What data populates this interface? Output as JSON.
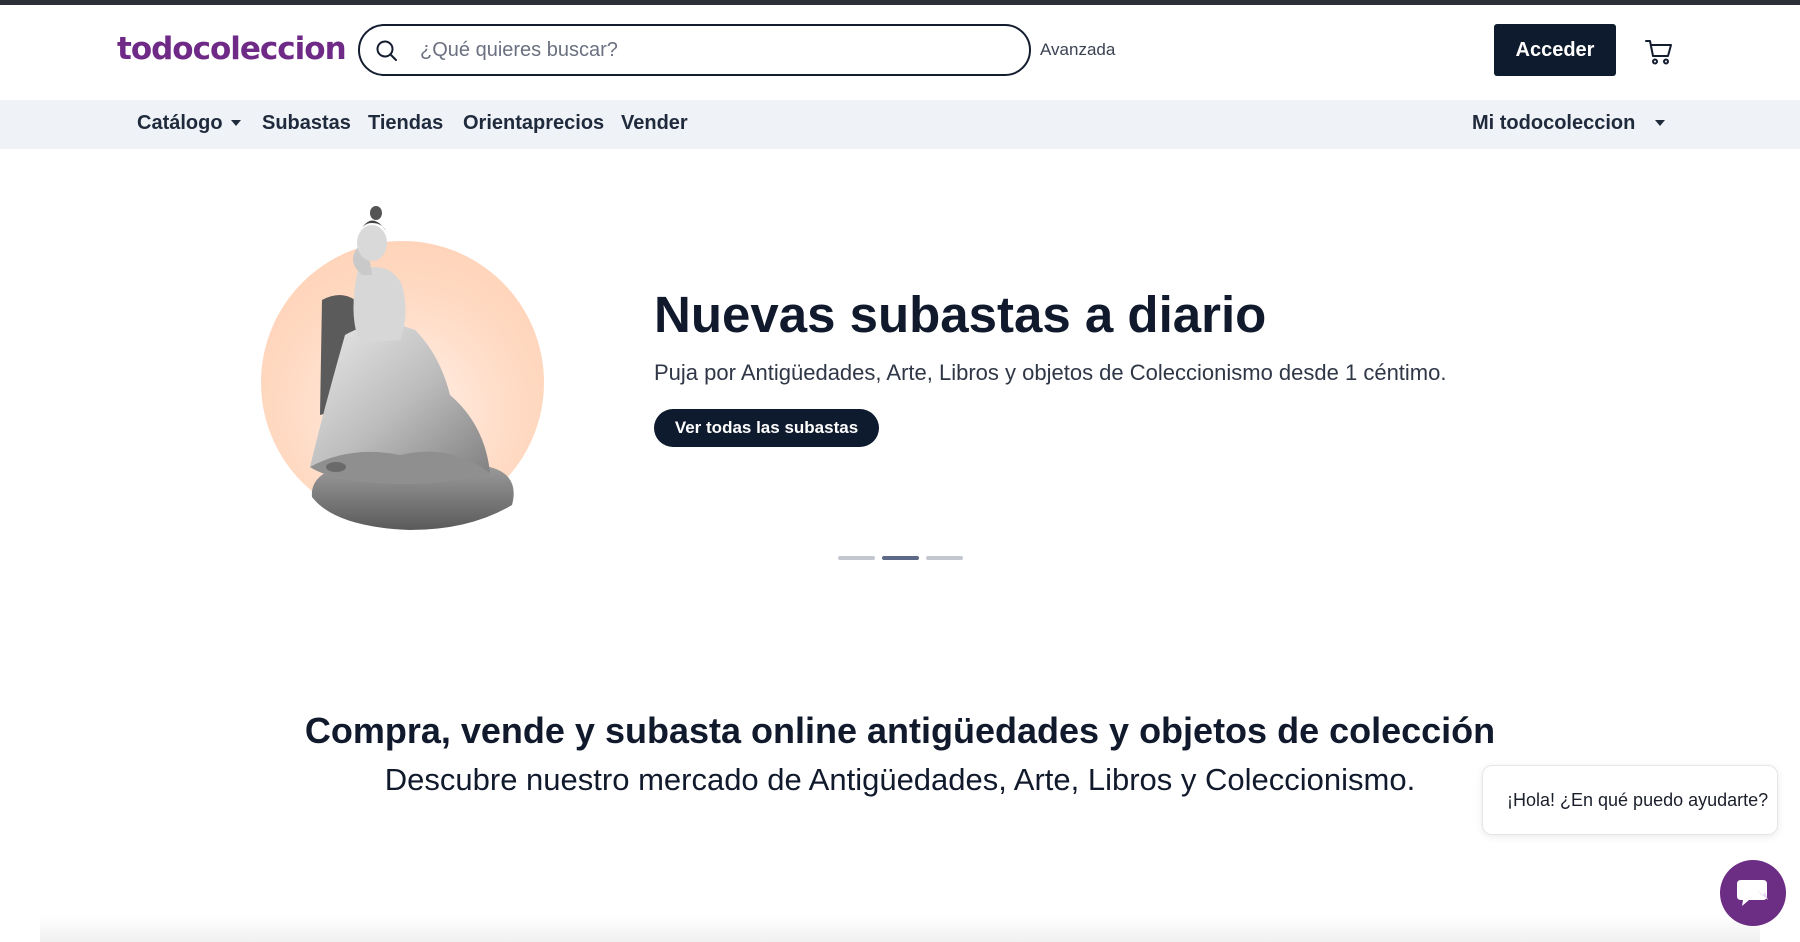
{
  "header": {
    "logo": "todocoleccion",
    "search_placeholder": "¿Qué quieres buscar?",
    "advanced_link": "Avanzada",
    "login_button": "Acceder",
    "icons": {
      "search": "search-icon",
      "cart": "cart-icon"
    }
  },
  "nav": {
    "items": [
      {
        "label": "Catálogo",
        "dropdown": true
      },
      {
        "label": "Subastas"
      },
      {
        "label": "Tiendas"
      },
      {
        "label": "Orientaprecios"
      },
      {
        "label": "Vender"
      }
    ],
    "account_menu": "Mi todocoleccion"
  },
  "hero": {
    "title": "Nuevas subastas a diario",
    "subtitle": "Puja por Antigüedades, Arte, Libros y objetos de Coleccionismo desde 1 céntimo.",
    "cta": "Ver todas las subastas",
    "slide_count": 3,
    "active_slide": 2
  },
  "section": {
    "title": "Compra, vende y subasta online antigüedades y objetos de colección",
    "subtitle": "Descubre nuestro mercado de Antigüedades, Arte, Libros y Coleccionismo."
  },
  "chat": {
    "greeting": "¡Hola! ¿En qué puedo ayudarte?",
    "icon": "chat-icon"
  },
  "colors": {
    "brand": "#6e2a86",
    "dark": "#0e1a2d",
    "nav_bg": "#eff2f6",
    "hero_circle": "#ffd9c2",
    "chat_button": "#6c2e85"
  }
}
